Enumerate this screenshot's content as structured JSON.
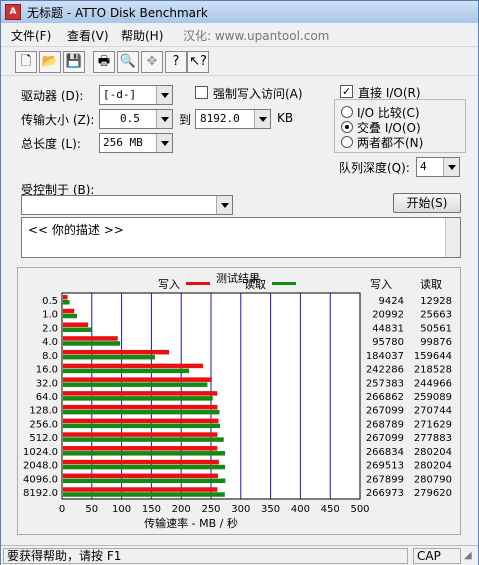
{
  "window": {
    "title": "无标题 - ATTO Disk Benchmark"
  },
  "menu": {
    "items": [
      "文件(F)",
      "查看(V)",
      "帮助(H)"
    ],
    "extra": "汉化: www.upantool.com"
  },
  "toolbar": {
    "icons": [
      "new-file-icon",
      "open-folder-icon",
      "save-icon",
      "print-icon",
      "print-preview-icon",
      "move-icon",
      "help-icon",
      "context-help-icon"
    ],
    "glyphs": [
      "🗋",
      "📂",
      "💾",
      "🖶",
      "🔍",
      "✥",
      "?",
      "↖?"
    ]
  },
  "settings": {
    "drive_label": "驱动器 (D):",
    "drive_value": "[-d-]",
    "force_write_label": "强制写入访问(A)",
    "force_write_checked": false,
    "transfer_label": "传输大小 (Z):",
    "transfer_from": "0.5",
    "transfer_to_label": "到",
    "transfer_to": "8192.0",
    "transfer_unit": "KB",
    "total_length_label": "总长度 (L):",
    "total_length": "256 MB",
    "direct_io_label": "直接 I/O(R)",
    "direct_io_checked": true,
    "io_compare_label": "I/O 比较(C)",
    "overlapped_io_label": "交叠 I/O(O)",
    "neither_label": "两者都不(N)",
    "selected_mode": "overlapped",
    "queue_depth_label": "队列深度(Q):",
    "queue_depth": "4",
    "controlled_by_label": "受控制于 (B):",
    "controlled_by_value": "",
    "start_button": "开始(S)",
    "description_text": "<<  你的描述  >>"
  },
  "results": {
    "title": "测试结果",
    "write_legend": "写入",
    "read_legend": "读取",
    "write_header": "写入",
    "read_header": "读取",
    "write_color": "#e81010",
    "read_color": "#138a13"
  },
  "chart_data": {
    "type": "bar",
    "orientation": "horizontal",
    "title": "测试结果",
    "xlabel": "传输速率 - MB / 秒",
    "ylabel": "",
    "xlim": [
      0,
      500
    ],
    "x_ticks": [
      0,
      50,
      100,
      150,
      200,
      250,
      300,
      350,
      400,
      450,
      500
    ],
    "grid": true,
    "legend": "top",
    "categories": [
      "0.5",
      "1.0",
      "2.0",
      "4.0",
      "8.0",
      "16.0",
      "32.0",
      "64.0",
      "128.0",
      "256.0",
      "512.0",
      "1024.0",
      "2048.0",
      "4096.0",
      "8192.0"
    ],
    "series": [
      {
        "name": "写入",
        "values_mb_s": [
          9.2,
          20.5,
          43.8,
          93.5,
          179.7,
          236.6,
          251.3,
          260.6,
          260.9,
          262.5,
          260.8,
          260.6,
          263.2,
          261.6,
          260.7
        ],
        "values": [
          9424,
          20992,
          44831,
          95780,
          184037,
          242286,
          257383,
          266862,
          267099,
          268789,
          267099,
          266834,
          269513,
          267899,
          266973
        ]
      },
      {
        "name": "读取",
        "values_mb_s": [
          12.6,
          25.1,
          49.4,
          97.5,
          155.9,
          213.3,
          244.0,
          253.0,
          264.3,
          265.3,
          271.4,
          273.6,
          273.6,
          274.2,
          273.2
        ],
        "values": [
          12928,
          25663,
          50561,
          99876,
          159644,
          218528,
          244966,
          259089,
          270744,
          271629,
          277883,
          280204,
          280204,
          280790,
          279620
        ]
      }
    ]
  },
  "status": {
    "help_text": "要获得帮助，请按 F1",
    "caps": "CAP"
  }
}
